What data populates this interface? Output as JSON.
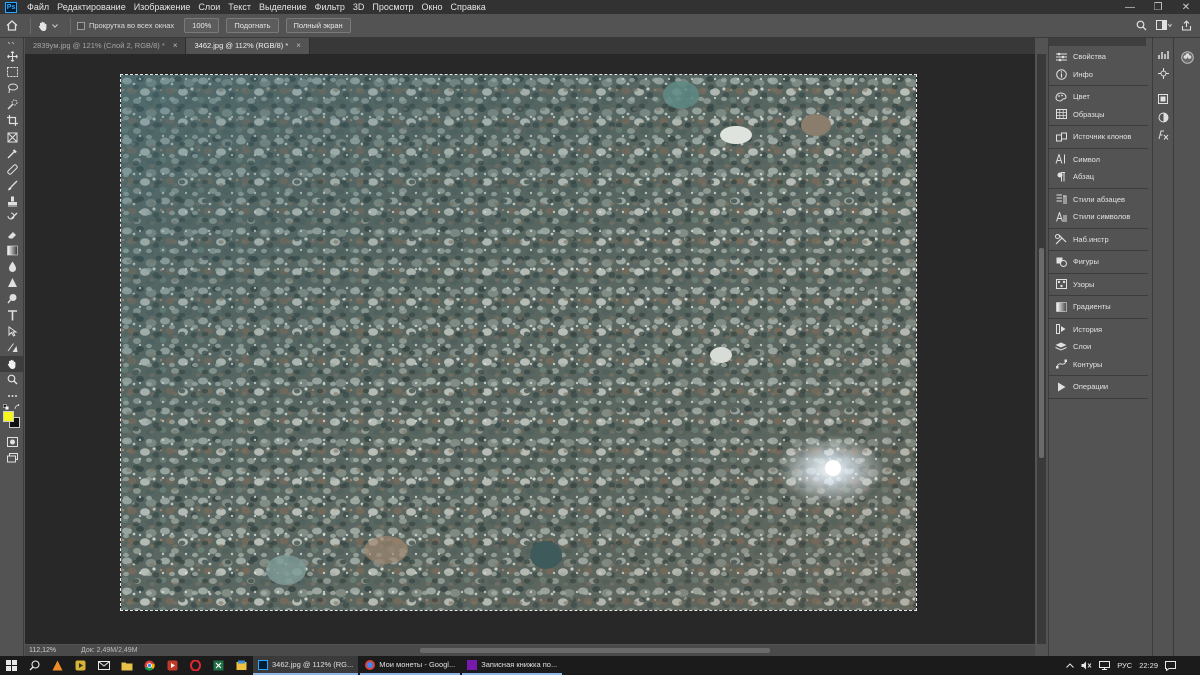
{
  "menubar": {
    "app_logo": "Ps",
    "items": [
      "Файл",
      "Редактирование",
      "Изображение",
      "Слои",
      "Текст",
      "Выделение",
      "Фильтр",
      "3D",
      "Просмотр",
      "Окно",
      "Справка"
    ],
    "minimize": "—",
    "maximize": "❐",
    "close": "✕"
  },
  "options": {
    "scroll_all_label": "Прокрутка во всех окнах",
    "zoom_100": "100%",
    "fit": "Подогнать",
    "fullscreen": "Полный экран"
  },
  "tabs": [
    {
      "label": "2839ум.jpg @ 121% (Слой 2, RGB/8) *",
      "active": false
    },
    {
      "label": "3462.jpg @ 112% (RGB/8) *",
      "active": true
    }
  ],
  "tab_close": "×",
  "status": {
    "zoom": "112,12%",
    "doc": "Док: 2,49M/2,49M"
  },
  "panels": {
    "groups": [
      [
        {
          "label": "Свойства",
          "icon": "properties-icon"
        },
        {
          "label": "Инфо",
          "icon": "info-icon"
        }
      ],
      [
        {
          "label": "Цвет",
          "icon": "color-icon"
        },
        {
          "label": "Образцы",
          "icon": "swatches-icon"
        }
      ],
      [
        {
          "label": "Источник клонов",
          "icon": "clone-source-icon"
        }
      ],
      [
        {
          "label": "Символ",
          "icon": "character-icon"
        },
        {
          "label": "Абзац",
          "icon": "paragraph-icon"
        }
      ],
      [
        {
          "label": "Стили абзацев",
          "icon": "paragraph-styles-icon"
        },
        {
          "label": "Стили символов",
          "icon": "character-styles-icon"
        }
      ],
      [
        {
          "label": "Наб.инстр",
          "icon": "tool-presets-icon"
        }
      ],
      [
        {
          "label": "Фигуры",
          "icon": "shapes-icon"
        }
      ],
      [
        {
          "label": "Узоры",
          "icon": "patterns-icon"
        }
      ],
      [
        {
          "label": "Градиенты",
          "icon": "gradients-icon"
        }
      ],
      [
        {
          "label": "История",
          "icon": "history-icon"
        },
        {
          "label": "Слои",
          "icon": "layers-icon"
        },
        {
          "label": "Контуры",
          "icon": "paths-icon"
        }
      ],
      [
        {
          "label": "Операции",
          "icon": "actions-icon"
        }
      ]
    ]
  },
  "colors": {
    "foreground": "#f5f519",
    "background": "#111111"
  },
  "taskbar": {
    "apps": [
      {
        "label": "3462.jpg @ 112% (RG...",
        "icon": "photoshop-icon"
      },
      {
        "label": "Мои монеты - Googl...",
        "icon": "chrome-icon"
      },
      {
        "label": "Записная книжка по...",
        "icon": "onenote-icon"
      }
    ],
    "lang": "РУС",
    "time": "22:29"
  }
}
